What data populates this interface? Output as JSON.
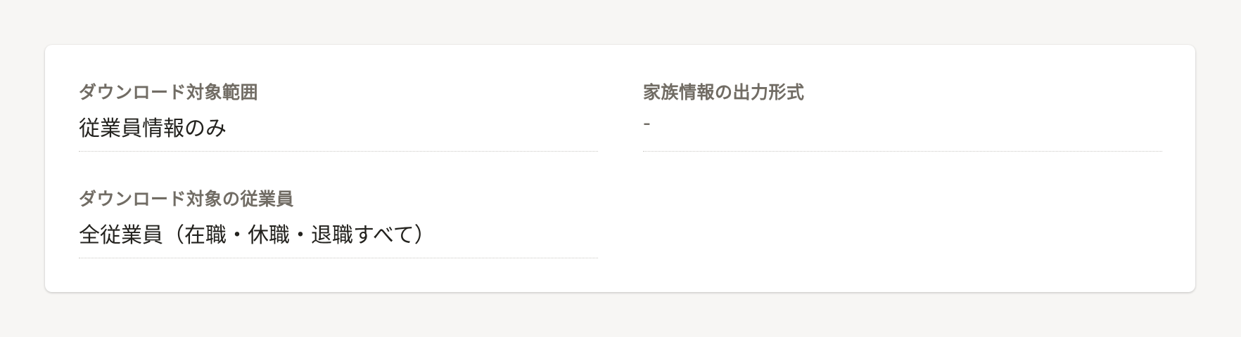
{
  "fields": [
    {
      "label": "ダウンロード対象範囲",
      "value": "従業員情報のみ"
    },
    {
      "label": "家族情報の出力形式",
      "value": "-"
    },
    {
      "label": "ダウンロード対象の従業員",
      "value": "全従業員（在職・休職・退職すべて）"
    }
  ],
  "colors": {
    "page_background": "#f7f6f4",
    "card_background": "#ffffff",
    "label_text": "#716c64",
    "value_text": "#23221e",
    "divider": "#c9c7c2"
  }
}
